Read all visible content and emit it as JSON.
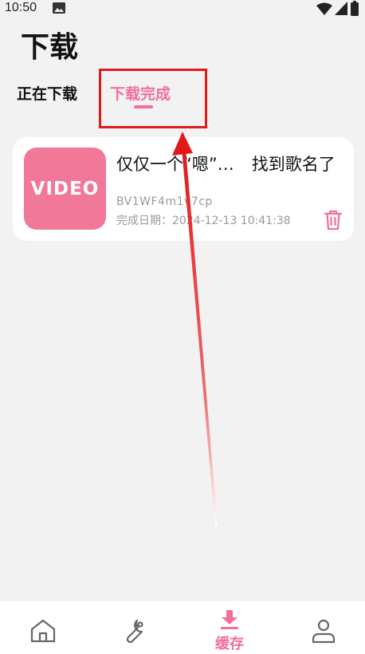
{
  "status": {
    "time": "10:50"
  },
  "header": {
    "title": "下载"
  },
  "tabs": {
    "downloading": "正在下载",
    "completed": "下载完成"
  },
  "item": {
    "thumb_label": "VIDEO",
    "title_part1": "仅仅一个“嗯”…",
    "title_part2": "找到歌名了",
    "id": "BV1WF4m1v7cp",
    "completed_label": "完成日期：",
    "completed_time": "2024-12-13 10:41:38"
  },
  "nav": {
    "cache_label": "缓存"
  },
  "colors": {
    "accent": "#f0709a",
    "highlight": "#e0191b",
    "background": "#f2f2f2"
  },
  "icons": [
    "image-icon",
    "wifi-icon",
    "signal-icon",
    "battery-icon",
    "trash-icon",
    "home-icon",
    "wrench-icon",
    "download-icon",
    "person-icon"
  ]
}
